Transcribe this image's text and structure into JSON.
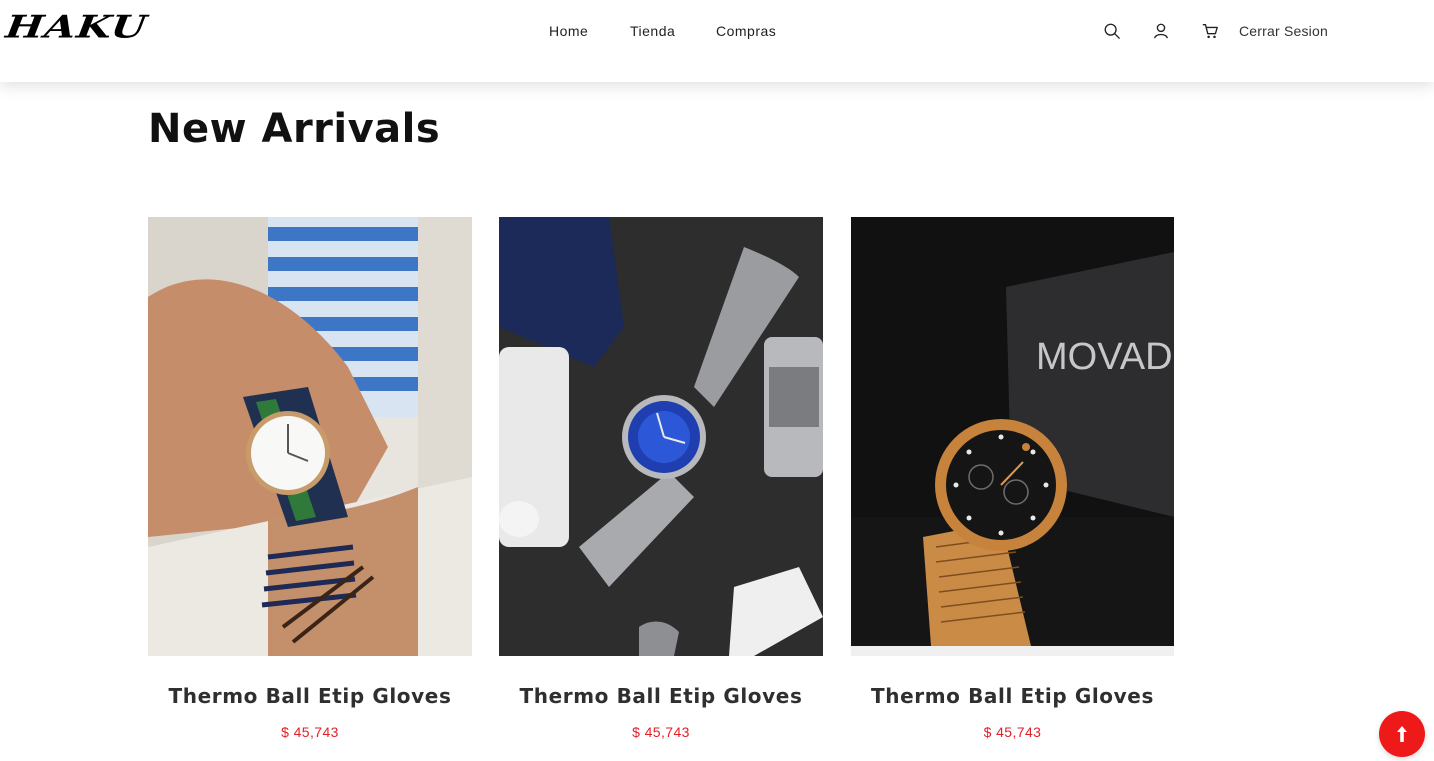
{
  "header": {
    "logo": "HAKU",
    "nav": [
      {
        "label": "Home"
      },
      {
        "label": "Tienda"
      },
      {
        "label": "Compras"
      }
    ],
    "icons": [
      "search-icon",
      "user-icon",
      "cart-icon"
    ],
    "logout_label": "Cerrar Sesion"
  },
  "main": {
    "title": "New Arrivals",
    "products": [
      {
        "name": "Thermo Ball Etip Gloves",
        "price": "$ 45,743",
        "image": "green-navy-strap-watch-photo"
      },
      {
        "name": "Thermo Ball Etip Gloves",
        "price": "$ 45,743",
        "image": "blue-dial-mesh-watch-photo"
      },
      {
        "name": "Thermo Ball Etip Gloves",
        "price": "$ 45,743",
        "image": "movado-gold-watch-photo",
        "image_text": "MOVADO"
      }
    ]
  },
  "colors": {
    "accent": "#ee1919",
    "price": "#e21f27",
    "text": "#2f2f2f"
  },
  "scroll_top": {
    "icon": "arrow-up-icon"
  }
}
